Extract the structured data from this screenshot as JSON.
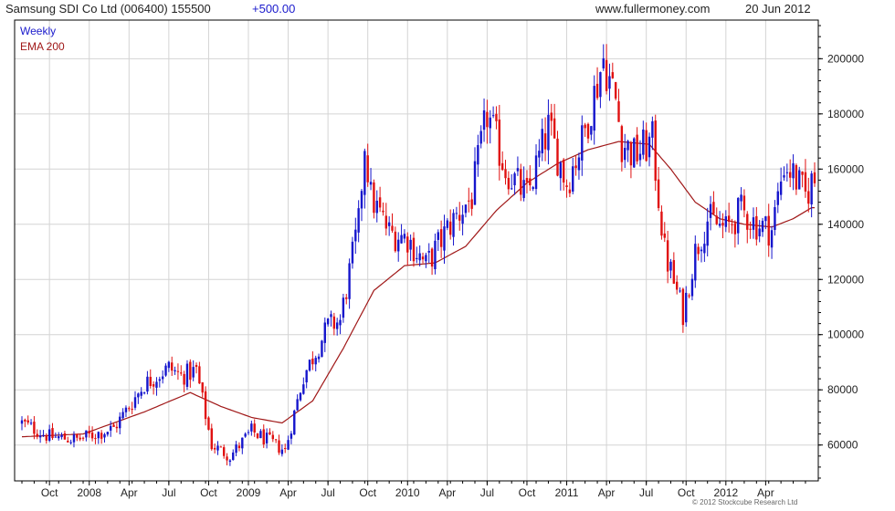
{
  "header": {
    "title": "Samsung SDI Co Ltd (006400) 155500",
    "change": "+500.00",
    "site": "www.fullermoney.com",
    "date": "20 Jun 2012"
  },
  "legend": [
    {
      "label": "Weekly",
      "color": "#1a1acc"
    },
    {
      "label": "EMA 200",
      "color": "#a01818"
    }
  ],
  "copyright": "© 2012 Stockcube Research Ltd",
  "colors": {
    "up": "#1515cc",
    "down": "#e01010",
    "ema": "#a01818",
    "grid": "#d4d4d4",
    "frame": "#000000"
  },
  "chart_data": {
    "type": "candlestick",
    "title": "Samsung SDI Co Ltd (006400) 155500",
    "y_axis_side": "right",
    "ylim": [
      47000,
      214000
    ],
    "y_ticks": [
      60000,
      80000,
      100000,
      120000,
      140000,
      160000,
      180000,
      200000
    ],
    "y_tick_labels": [
      "60000",
      "80000",
      "100000",
      "120000",
      "140000",
      "160000",
      "180000",
      "200000"
    ],
    "x_tick_labels": [
      "Oct",
      "2008",
      "Apr",
      "Jul",
      "Oct",
      "2009",
      "Apr",
      "Jul",
      "Oct",
      "2010",
      "Apr",
      "Jul",
      "Oct",
      "2011",
      "Apr",
      "Jul",
      "Oct",
      "2012",
      "Apr"
    ],
    "x_tick_week_index": [
      9,
      22,
      35,
      48,
      61,
      74,
      87,
      100,
      113,
      126,
      139,
      152,
      165,
      178,
      191,
      204,
      217,
      230,
      243
    ],
    "grid": true,
    "series": [
      {
        "name": "Weekly",
        "kind": "weekly_price",
        "key_points_week": [
          0,
          9,
          18,
          30,
          40,
          48,
          52,
          57,
          62,
          68,
          75,
          86,
          92,
          100,
          104,
          110,
          112,
          114,
          120,
          126,
          132,
          140,
          147,
          152,
          158,
          165,
          172,
          178,
          183,
          190,
          194,
          196,
          200,
          206,
          210,
          216,
          220,
          224,
          230,
          235,
          240,
          245,
          249,
          252,
          256,
          258
        ],
        "key_points_value": [
          68000,
          63000,
          62000,
          66000,
          82000,
          88000,
          85000,
          87000,
          60000,
          56000,
          65000,
          58000,
          85000,
          103000,
          105000,
          140000,
          170000,
          150000,
          137000,
          135000,
          125000,
          140000,
          150000,
          180000,
          160000,
          150000,
          175000,
          155000,
          170000,
          200000,
          185000,
          170000,
          165000,
          170000,
          130000,
          108000,
          130000,
          142000,
          138000,
          145000,
          140000,
          138000,
          162000,
          158000,
          150000,
          155500
        ]
      },
      {
        "name": "EMA 200",
        "kind": "ema",
        "key_points_week": [
          0,
          20,
          40,
          55,
          65,
          75,
          85,
          95,
          105,
          115,
          125,
          135,
          145,
          155,
          165,
          175,
          185,
          195,
          205,
          212,
          220,
          228,
          236,
          245,
          252,
          258
        ],
        "key_points_value": [
          63000,
          64000,
          72000,
          79000,
          74000,
          70000,
          68000,
          76000,
          95000,
          116000,
          125000,
          126000,
          132000,
          145000,
          155000,
          162000,
          167000,
          170000,
          169000,
          160000,
          148000,
          142000,
          140000,
          139000,
          142000,
          146000
        ]
      }
    ]
  }
}
